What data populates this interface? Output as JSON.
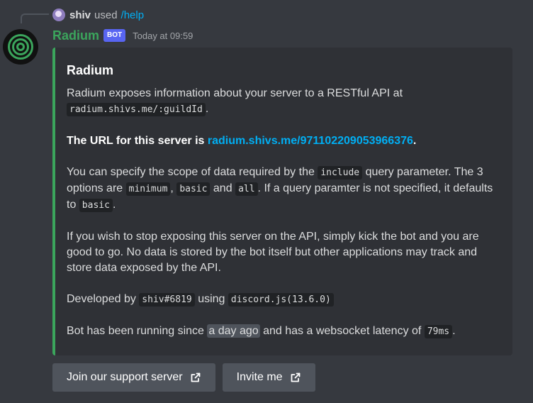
{
  "reply": {
    "user": "shiv",
    "used_text": "used",
    "command": "/help"
  },
  "message": {
    "author": "Radium",
    "bot_tag": "BOT",
    "timestamp": "Today at 09:59"
  },
  "embed": {
    "accent_color": "#3ba55c",
    "title": "Radium",
    "p1_text": "Radium exposes information about your server to a RESTful API at",
    "p1_code": "radium.shivs.me/:guildId",
    "p2_prefix": "The URL for this server is",
    "p2_link": "radium.shivs.me/971102209053966376",
    "p3_a": "You can specify the scope of data required by the",
    "p3_code_include": "include",
    "p3_b": "query parameter. The 3 options are",
    "p3_code_minimum": "minimum",
    "p3_code_basic": "basic",
    "p3_and": "and",
    "p3_code_all": "all",
    "p3_c": ". If a query paramter is not specified, it defaults to",
    "p3_code_basic2": "basic",
    "p4": "If you wish to stop exposing this server on the API, simply kick the bot and you are good to go. No data is stored by the bot itself but other applications may track and store data exposed by the API.",
    "p5_a": "Developed by",
    "p5_code_user": "shiv#6819",
    "p5_using": "using",
    "p5_code_lib": "discord.js(13.6.0)",
    "p6_a": "Bot has been running since",
    "p6_time": "a day ago",
    "p6_b": "and has a websocket latency of",
    "p6_code_latency": "79ms"
  },
  "buttons": [
    {
      "label": "Join our support server",
      "icon": "external-link-icon"
    },
    {
      "label": "Invite me",
      "icon": "external-link-icon"
    }
  ]
}
